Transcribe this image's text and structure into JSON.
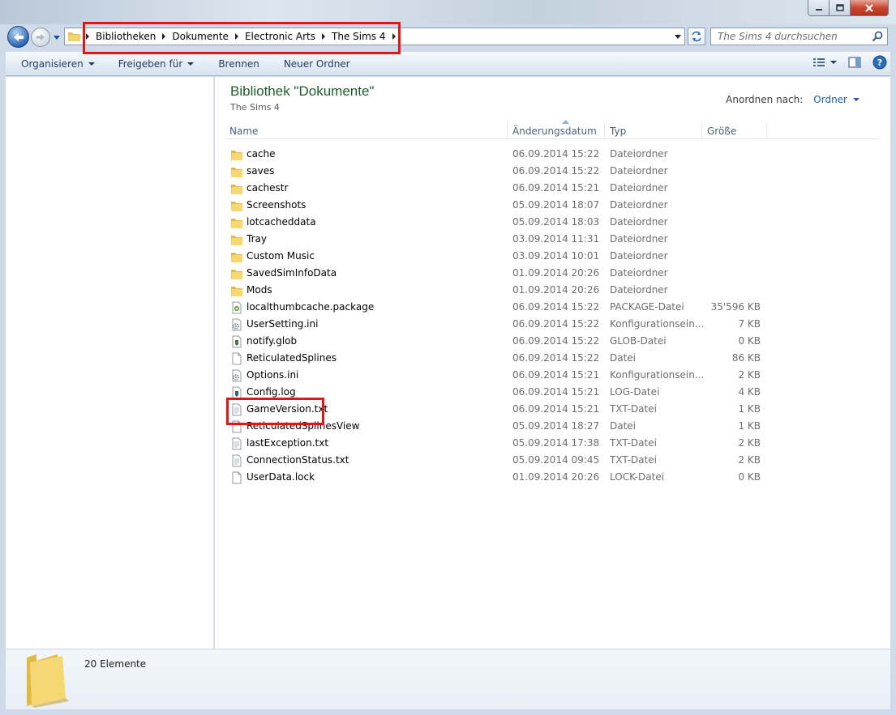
{
  "window": {
    "caption_buttons": [
      "minimize",
      "maximize",
      "close"
    ]
  },
  "address_bar": {
    "breadcrumbs": [
      "Bibliotheken",
      "Dokumente",
      "Electronic Arts",
      "The Sims 4"
    ],
    "search_placeholder": "The Sims 4 durchsuchen"
  },
  "toolbar": {
    "organize": "Organisieren",
    "share": "Freigeben für",
    "burn": "Brennen",
    "new_folder": "Neuer Ordner"
  },
  "library": {
    "title": "Bibliothek \"Dokumente\"",
    "subtitle": "The Sims 4",
    "arrange_label": "Anordnen nach:",
    "arrange_value": "Ordner"
  },
  "columns": {
    "name": "Name",
    "date": "Änderungsdatum",
    "type": "Typ",
    "size": "Größe"
  },
  "files": [
    {
      "name": "cache",
      "date": "06.09.2014 15:22",
      "type": "Dateiordner",
      "size": "",
      "icon": "folder-icon"
    },
    {
      "name": "saves",
      "date": "06.09.2014 15:22",
      "type": "Dateiordner",
      "size": "",
      "icon": "folder-icon"
    },
    {
      "name": "cachestr",
      "date": "06.09.2014 15:21",
      "type": "Dateiordner",
      "size": "",
      "icon": "folder-icon"
    },
    {
      "name": "Screenshots",
      "date": "05.09.2014 18:07",
      "type": "Dateiordner",
      "size": "",
      "icon": "folder-icon"
    },
    {
      "name": "lotcacheddata",
      "date": "05.09.2014 18:03",
      "type": "Dateiordner",
      "size": "",
      "icon": "folder-icon"
    },
    {
      "name": "Tray",
      "date": "03.09.2014 11:31",
      "type": "Dateiordner",
      "size": "",
      "icon": "folder-icon"
    },
    {
      "name": "Custom Music",
      "date": "03.09.2014 10:01",
      "type": "Dateiordner",
      "size": "",
      "icon": "folder-icon"
    },
    {
      "name": "SavedSimInfoData",
      "date": "01.09.2014 20:26",
      "type": "Dateiordner",
      "size": "",
      "icon": "folder-icon"
    },
    {
      "name": "Mods",
      "date": "01.09.2014 20:26",
      "type": "Dateiordner",
      "size": "",
      "icon": "folder-icon"
    },
    {
      "name": "localthumbcache.package",
      "date": "06.09.2014 15:22",
      "type": "PACKAGE-Datei",
      "size": "35'596 KB",
      "icon": "package-file-icon"
    },
    {
      "name": "UserSetting.ini",
      "date": "06.09.2014 15:22",
      "type": "Konfigurationsein...",
      "size": "7 KB",
      "icon": "settings-file-icon"
    },
    {
      "name": "notify.glob",
      "date": "06.09.2014 15:22",
      "type": "GLOB-Datei",
      "size": "0 KB",
      "icon": "glob-file-icon"
    },
    {
      "name": "ReticulatedSplines",
      "date": "06.09.2014 15:22",
      "type": "Datei",
      "size": "86 KB",
      "icon": "file-icon"
    },
    {
      "name": "Options.ini",
      "date": "06.09.2014 15:21",
      "type": "Konfigurationsein...",
      "size": "2 KB",
      "icon": "settings-file-icon"
    },
    {
      "name": "Config.log",
      "date": "06.09.2014 15:21",
      "type": "LOG-Datei",
      "size": "4 KB",
      "icon": "log-file-icon"
    },
    {
      "name": "GameVersion.txt",
      "date": "06.09.2014 15:21",
      "type": "TXT-Datei",
      "size": "1 KB",
      "icon": "text-file-icon"
    },
    {
      "name": "ReticulatedSplinesView",
      "date": "05.09.2014 18:27",
      "type": "Datei",
      "size": "1 KB",
      "icon": "file-icon"
    },
    {
      "name": "lastException.txt",
      "date": "05.09.2014 17:38",
      "type": "TXT-Datei",
      "size": "2 KB",
      "icon": "text-file-icon"
    },
    {
      "name": "ConnectionStatus.txt",
      "date": "05.09.2014 09:45",
      "type": "TXT-Datei",
      "size": "2 KB",
      "icon": "text-file-icon"
    },
    {
      "name": "UserData.lock",
      "date": "01.09.2014 20:26",
      "type": "LOCK-Datei",
      "size": "0 KB",
      "icon": "file-icon"
    }
  ],
  "details": {
    "count": "20 Elemente"
  },
  "colors": {
    "title_green": "#1e5c2b",
    "link_blue": "#1c5bb4",
    "highlight_red": "#e0161b",
    "folder_yellow": "#f3d36b"
  }
}
